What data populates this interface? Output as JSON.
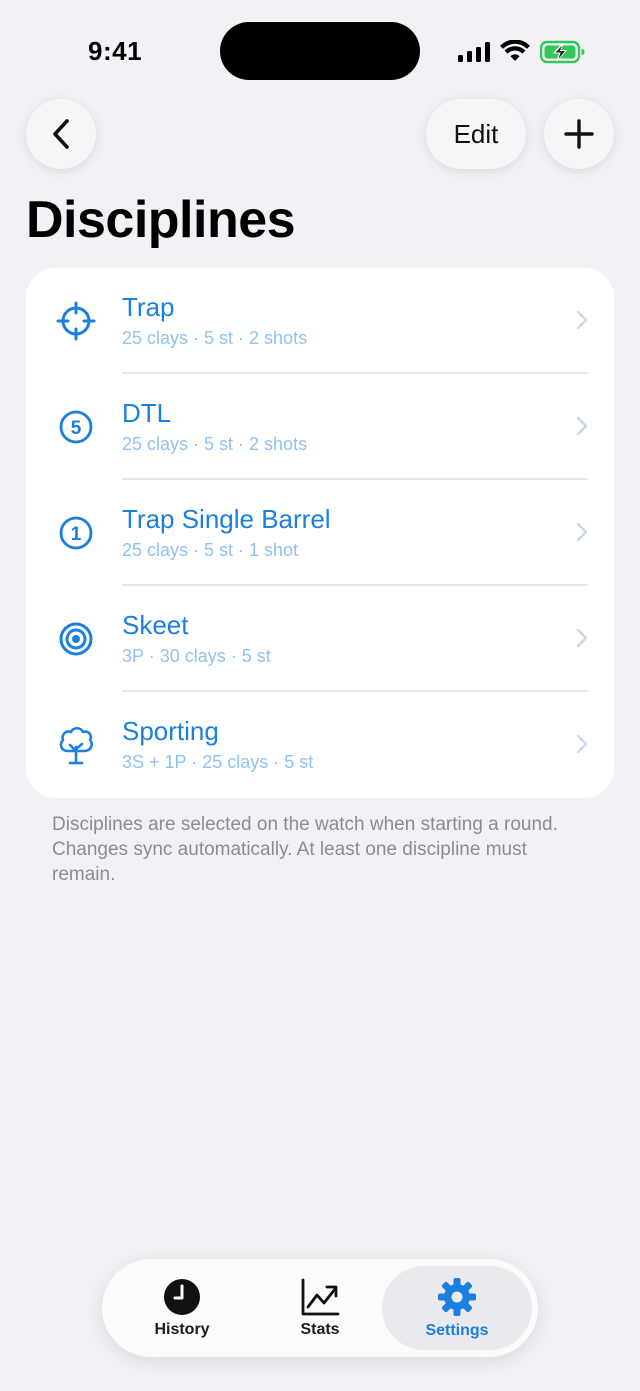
{
  "status_bar": {
    "time": "9:41"
  },
  "nav": {
    "edit_label": "Edit"
  },
  "page": {
    "title": "Disciplines"
  },
  "disciplines": [
    {
      "name": "Trap",
      "detail": "25 clays · 5 st · 2 shots",
      "icon": "crosshair-icon"
    },
    {
      "name": "DTL",
      "detail": "25 clays · 5 st · 2 shots",
      "icon": "number-5-circle-icon"
    },
    {
      "name": "Trap Single Barrel",
      "detail": "25 clays · 5 st · 1 shot",
      "icon": "number-1-circle-icon"
    },
    {
      "name": "Skeet",
      "detail": "3P · 30 clays · 5 st",
      "icon": "target-icon"
    },
    {
      "name": "Sporting",
      "detail": "3S + 1P · 25 clays · 5 st",
      "icon": "tree-icon"
    }
  ],
  "footnote": "Disciplines are selected on the watch when starting a round. Changes sync automatically. At least one discipline must remain.",
  "tabbar": {
    "tabs": [
      {
        "label": "History",
        "icon": "clock-icon"
      },
      {
        "label": "Stats",
        "icon": "chart-line-icon"
      },
      {
        "label": "Settings",
        "icon": "gear-icon",
        "selected": true
      }
    ]
  },
  "colors": {
    "accent": "#1a7fdf",
    "subtitle": "#8fc2f0",
    "background": "#f2f1f6",
    "battery": "#34c759"
  }
}
